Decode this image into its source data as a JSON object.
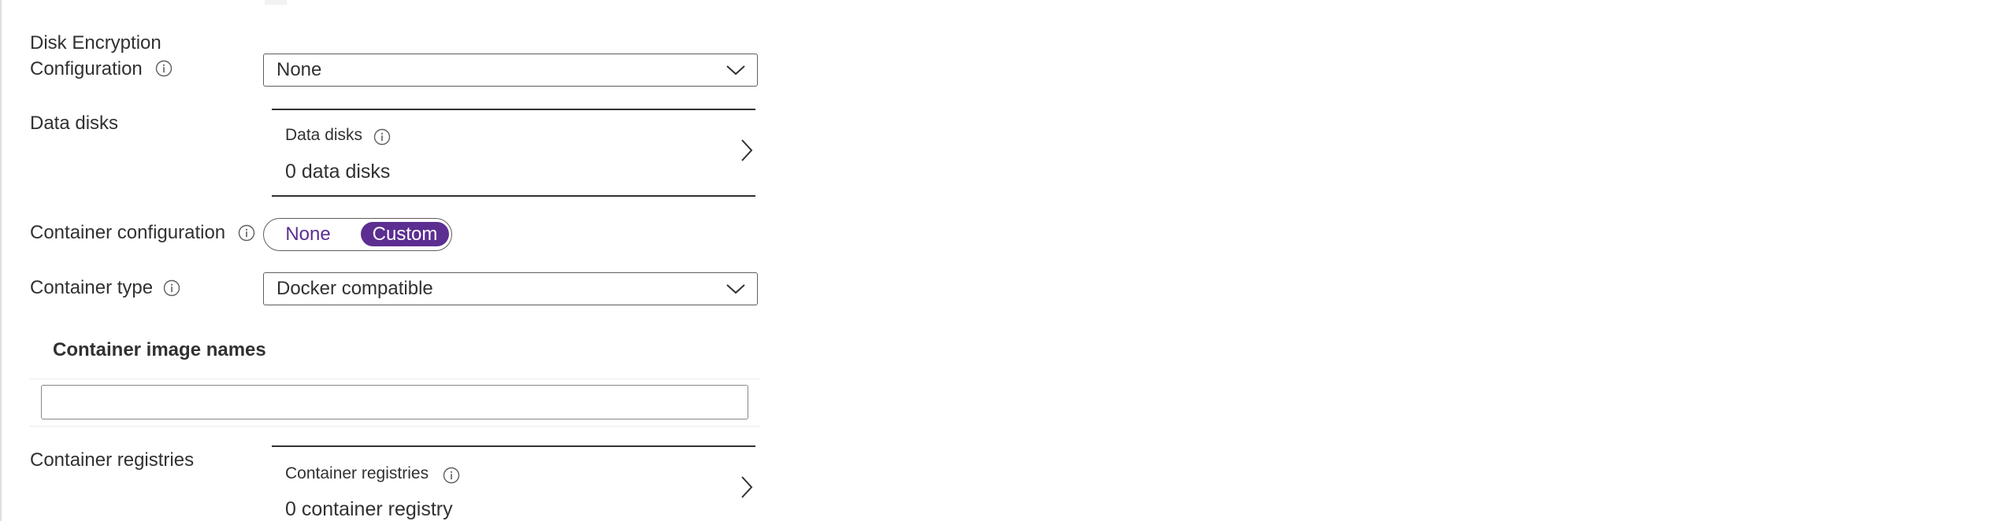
{
  "disk_encryption": {
    "label_line1": "Disk Encryption",
    "label_line2": "Configuration",
    "info_icon": "info-icon",
    "selected": "None"
  },
  "data_disks": {
    "label": "Data disks",
    "card_title": "Data disks",
    "info_icon": "info-icon",
    "card_value": "0 data disks"
  },
  "container_configuration": {
    "label": "Container configuration",
    "info_icon": "info-icon",
    "options": [
      "None",
      "Custom"
    ],
    "selected": "Custom",
    "accent_color": "#5c2e91"
  },
  "container_type": {
    "label": "Container type",
    "info_icon": "info-icon",
    "selected": "Docker compatible"
  },
  "container_image_names": {
    "title": "Container image names",
    "input_value": ""
  },
  "container_registries": {
    "label": "Container registries",
    "card_title": "Container registries",
    "info_icon": "info-icon",
    "card_value": "0 container registry"
  }
}
